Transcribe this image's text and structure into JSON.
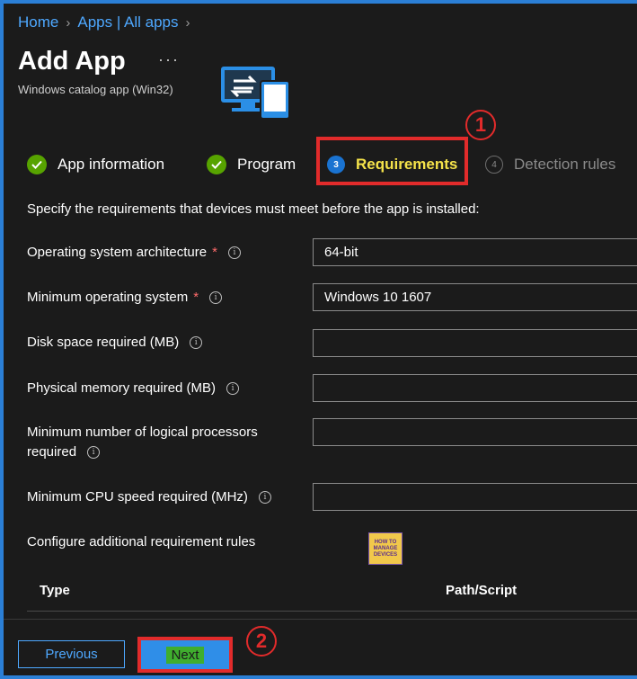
{
  "breadcrumb": {
    "home": "Home",
    "apps": "Apps | All apps"
  },
  "header": {
    "title": "Add App",
    "more": "···",
    "subtitle": "Windows catalog app (Win32)"
  },
  "steps": [
    {
      "label": "App information",
      "state": "done"
    },
    {
      "label": "Program",
      "state": "done"
    },
    {
      "number": "3",
      "label": "Requirements",
      "state": "active"
    },
    {
      "number": "4",
      "label": "Detection rules",
      "state": "pending"
    }
  ],
  "callouts": {
    "one": "1",
    "two": "2"
  },
  "intro": "Specify the requirements that devices must meet before the app is installed:",
  "fields": {
    "os_arch": {
      "label": "Operating system architecture",
      "required": "*",
      "value": "64-bit"
    },
    "min_os": {
      "label": "Minimum operating system",
      "required": "*",
      "value": "Windows 10 1607"
    },
    "disk": {
      "label": "Disk space required (MB)",
      "value": ""
    },
    "memory": {
      "label": "Physical memory required (MB)",
      "value": ""
    },
    "processors": {
      "label_line1": "Minimum number of logical processors",
      "label_line2": "required",
      "value": ""
    },
    "cpu": {
      "label": "Minimum CPU speed required (MHz)",
      "value": ""
    }
  },
  "additional_rules": "Configure additional requirement rules",
  "watermark": {
    "line1": "HOW TO",
    "line2": "MANAGE",
    "line3": "DEVICES"
  },
  "table": {
    "col_type": "Type",
    "col_path": "Path/Script"
  },
  "footer": {
    "previous": "Previous",
    "next": "Next"
  },
  "colors": {
    "accent": "#2b7fd6",
    "link": "#4ea8ff",
    "check": "#57a300",
    "highlight": "#e22b2b",
    "active_step": "#f5e34a"
  },
  "icons": [
    "chevron-right-icon",
    "check-icon",
    "info-icon",
    "remote-desktop-icon"
  ]
}
